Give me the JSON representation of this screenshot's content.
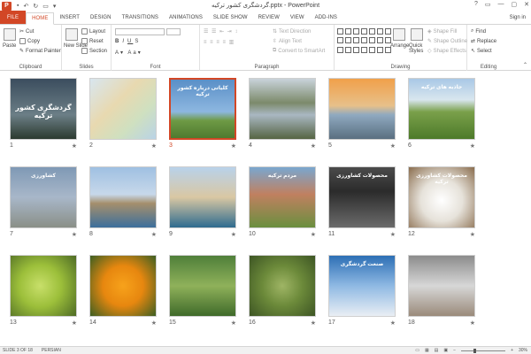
{
  "window": {
    "title": "گردشگری کشور ترکیه.pptx - PowerPoint",
    "controls": [
      "?",
      "▭",
      "—",
      "▢",
      "✕"
    ]
  },
  "tabs": [
    "FILE",
    "HOME",
    "INSERT",
    "DESIGN",
    "TRANSITIONS",
    "ANIMATIONS",
    "SLIDE SHOW",
    "REVIEW",
    "VIEW",
    "ADD-INS"
  ],
  "signin": "Sign in",
  "ribbon": {
    "clipboard": {
      "label": "Clipboard",
      "paste": "Paste",
      "cut": "Cut",
      "copy": "Copy",
      "format_painter": "Format Painter"
    },
    "slides": {
      "label": "Slides",
      "new_slide": "New Slide",
      "layout": "Layout",
      "reset": "Reset",
      "section": "Section"
    },
    "font": {
      "label": "Font"
    },
    "paragraph": {
      "label": "Paragraph",
      "text_direction": "Text Direction",
      "align_text": "Align Text",
      "convert_smartart": "Convert to SmartArt"
    },
    "drawing": {
      "label": "Drawing",
      "arrange": "Arrange",
      "quick_styles": "Quick Styles",
      "shape_fill": "Shape Fill",
      "shape_outline": "Shape Outline",
      "shape_effects": "Shape Effects"
    },
    "editing": {
      "label": "Editing",
      "find": "Find",
      "replace": "Replace",
      "select": "Select"
    }
  },
  "slides": [
    {
      "n": "1",
      "text": "گردشگری کشور ترکیه",
      "bg": "linear-gradient(#3b4d5e,#6b7e86 60%,#2c3a2f)",
      "selected": false
    },
    {
      "n": "2",
      "text": "",
      "bg": "linear-gradient(135deg,#d8e6ef,#e8d9b0 40%,#cfe0c0 70%,#b9d3e6)",
      "selected": false
    },
    {
      "n": "3",
      "text": "کلیاتی درباره کشور ترکیه",
      "bg": "linear-gradient(#5a8fc7,#8db7e0 55%,#6e9a45 70%,#4f7a2f)",
      "selected": true
    },
    {
      "n": "4",
      "text": "",
      "bg": "linear-gradient(#c9d3db,#7c8a6b 40%,#a9b7c2 60%,#556443)",
      "selected": false
    },
    {
      "n": "5",
      "text": "",
      "bg": "linear-gradient(#f1a04a,#e7c08a 45%,#8fa9c0 60%,#5a6f80)",
      "selected": false
    },
    {
      "n": "6",
      "text": "جاذبه های ترکیه",
      "bg": "linear-gradient(#a9c8e6,#d8e6ee 35%,#7aa04a 55%,#4d7a2a)",
      "selected": false
    },
    {
      "n": "7",
      "text": "کشاورزی",
      "bg": "linear-gradient(#7f99b5,#a8b7c9 50%,#8a8f87)",
      "selected": false
    },
    {
      "n": "8",
      "text": "",
      "bg": "linear-gradient(#9fc0e2,#c7d8ea 45%,#a58f6c 60%,#3c6f9c)",
      "selected": false
    },
    {
      "n": "9",
      "text": "",
      "bg": "linear-gradient(#b9d2ea,#d9c7a3 50%,#2f6b8f)",
      "selected": false
    },
    {
      "n": "10",
      "text": "مردم ترکیه",
      "bg": "linear-gradient(#7aa7cf,#c08060 45%,#6a8f3f)",
      "selected": false
    },
    {
      "n": "11",
      "text": "محصولات کشاورزی",
      "bg": "linear-gradient(#4b4b4b,#2b2b2b 40%,#6b6b6b)",
      "selected": false
    },
    {
      "n": "12",
      "text": "محصولات کشاورزی ترکیه",
      "bg": "radial-gradient(circle at 50% 55%,#ffffff,#e6e2da 45%,#8a6d4e)",
      "selected": false
    },
    {
      "n": "13",
      "text": "",
      "bg": "radial-gradient(circle at 45% 50%,#c8df6a,#9cbf3a 45%,#4e6b25)",
      "selected": false
    },
    {
      "n": "14",
      "text": "",
      "bg": "radial-gradient(circle at 50% 50%,#f7a21b,#e7870f 45%,#3d5f22)",
      "selected": false
    },
    {
      "n": "15",
      "text": "",
      "bg": "linear-gradient(#4f7f3a,#8fb15a 50%,#3f6a2a)",
      "selected": false
    },
    {
      "n": "16",
      "text": "",
      "bg": "radial-gradient(circle at 50% 50%,#9fb565,#6c8a3a 45%,#3d5524)",
      "selected": false
    },
    {
      "n": "17",
      "text": "صنعت گردشگری",
      "bg": "linear-gradient(#2d6fb5,#8fb9e3 50%,#e9eef4)",
      "selected": false
    },
    {
      "n": "18",
      "text": "",
      "bg": "linear-gradient(#8c8c8c,#d7d7d7 50%,#9a8a7a)",
      "selected": false
    }
  ],
  "status": {
    "slide_info": "SLIDE 3 OF 18",
    "language": "PERSIAN",
    "zoom": "30%"
  }
}
